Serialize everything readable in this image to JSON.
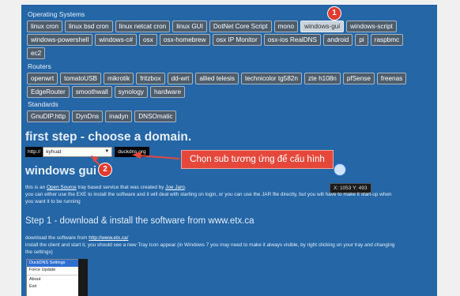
{
  "sections": {
    "os_label": "Operating Systems",
    "os_rows": [
      [
        "linux cron",
        "linux bsd cron",
        "linux netcat cron",
        "linux GUI",
        "DotNet Core Script",
        "mono",
        "windows-gui",
        "windows-script"
      ],
      [
        "windows-powershell",
        "windows-c#",
        "osx",
        "osx-homebrew",
        "osx IP Monitor",
        "osx-ios RealDNS",
        "android",
        "pi",
        "raspbmc"
      ],
      [
        "ec2"
      ]
    ],
    "active_tag": "windows-gui",
    "routers_label": "Routers",
    "router_rows": [
      [
        "openwrt",
        "tomatoUSB",
        "mikrotik",
        "fritzbox",
        "dd-wrt",
        "allied telesis",
        "technicolor tg582n",
        "zte h108n",
        "pfSense",
        "freenas"
      ],
      [
        "EdgeRouter",
        "smoothwall",
        "synology",
        "hardware"
      ]
    ],
    "standards_label": "Standards",
    "standards": [
      "GnuDIP.http",
      "DynDns",
      "inadyn",
      "DNSOmatic"
    ]
  },
  "first_step": {
    "title": "first step - choose a domain.",
    "protocol": "http://",
    "subdomain_value": "kyhuat",
    "suffix": "duckdns.org"
  },
  "annotation": {
    "badge1": "1",
    "badge2": "2",
    "callout": "Chọn sub tương ứng để cấu hình",
    "arrow_color": "#e5483b"
  },
  "coords": "X: 1053 Y: 493",
  "windows_gui": {
    "title": "windows gui",
    "line1_pre": "this is an ",
    "line1_link1": "Open Source",
    "line1_mid": " tray based service that was created by ",
    "line1_link2": "Joe Jaro",
    "line1_post": ".",
    "line2": "you can either use the EXE to install the software and it will deal with starting on login, or you can use the JAR file directly, but you will have to make it start-up when",
    "line3": "you want it to be running",
    "step1": "Step 1 - download & install the software from www.etx.ca",
    "dl_pre": "download the software from ",
    "dl_link": "http://www.etx.ca/",
    "install1": "install the client and start it, you should see a new Tray Icon appear (in Windows 7 you may need to make it always visible, by right clicking on your tray and changing",
    "install2": "the settings)"
  },
  "tray_menu": {
    "items": [
      "DuckDNS Settings",
      "Force Update",
      "About",
      "Exit"
    ]
  }
}
